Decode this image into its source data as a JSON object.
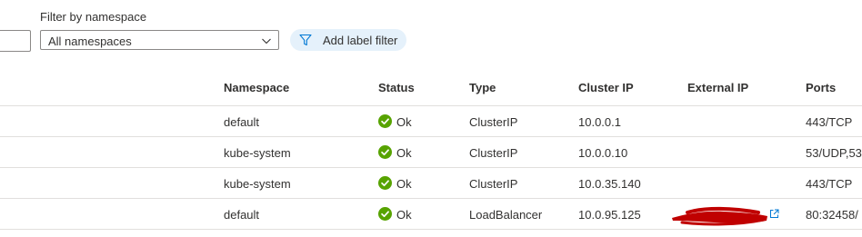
{
  "filter": {
    "namespace_label": "Filter by namespace",
    "namespace_value": "All namespaces",
    "add_label_filter": "Add label filter"
  },
  "table": {
    "headers": {
      "namespace": "Namespace",
      "status": "Status",
      "type": "Type",
      "cluster_ip": "Cluster IP",
      "external_ip": "External IP",
      "ports": "Ports"
    },
    "rows": [
      {
        "namespace": "default",
        "status": "Ok",
        "type": "ClusterIP",
        "cluster_ip": "10.0.0.1",
        "external_ip": "",
        "ports": "443/TCP"
      },
      {
        "namespace": "kube-system",
        "status": "Ok",
        "type": "ClusterIP",
        "cluster_ip": "10.0.0.10",
        "external_ip": "",
        "ports": "53/UDP,53"
      },
      {
        "namespace": "kube-system",
        "status": "Ok",
        "type": "ClusterIP",
        "cluster_ip": "10.0.35.140",
        "external_ip": "",
        "ports": "443/TCP"
      },
      {
        "namespace": "default",
        "status": "Ok",
        "type": "LoadBalancer",
        "cluster_ip": "10.0.95.125",
        "external_ip": "",
        "ports": "80:32458/"
      }
    ]
  },
  "icons": {
    "status": "check-circle-icon",
    "dropdown": "chevron-down-icon",
    "filter": "funnel-icon",
    "external_link": "open-external-icon"
  },
  "colors": {
    "ok_green": "#57a300",
    "accent_blue": "#0078d4",
    "pill_bg": "#e5f1fb",
    "redaction": "#c00000"
  }
}
